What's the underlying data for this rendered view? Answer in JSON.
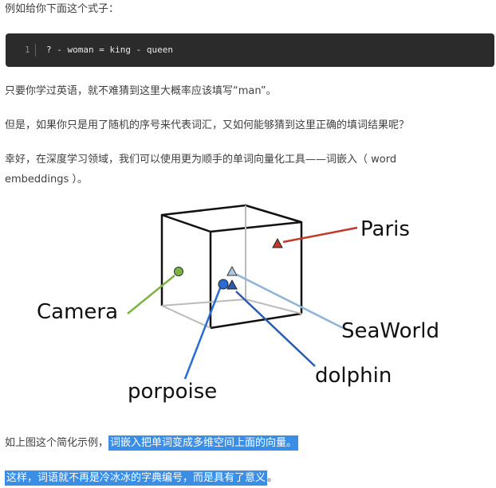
{
  "intro": "例如给你下面这个式子：",
  "code": {
    "line_number": "1",
    "text": "? - woman = king - queen"
  },
  "para1": "只要你学过英语，就不难猜到这里大概率应该填写“man”。",
  "para2": "但是，如果你只是用了随机的序号来代表词汇，又如何能够猜到这里正确的填词结果呢？",
  "para3_line1": "幸好，在深度学习领域，我们可以使用更为顺手的单词向量化工具——词嵌入（ word",
  "para3_line2": "embeddings ）。",
  "diagram_labels": {
    "paris": "Paris",
    "camera": "Camera",
    "seaworld": "SeaWorld",
    "dolphin": "dolphin",
    "porpoise": "porpoise"
  },
  "para4_prefix": "如上图这个简化示例，",
  "para4_highlight": "词嵌入把单词变成多维空间上面的向量。",
  "para5_highlight": "这样，词语就不再是冷冰冰的字典编号，而是具有了意义",
  "para5_suffix": "。",
  "colors": {
    "paris": "#c0392b",
    "camera": "#7cb342",
    "seaworld": "#8fb4d6",
    "dolphin": "#2a5db0",
    "porpoise": "#2a6cd4",
    "highlight": "#3a8ee6"
  }
}
